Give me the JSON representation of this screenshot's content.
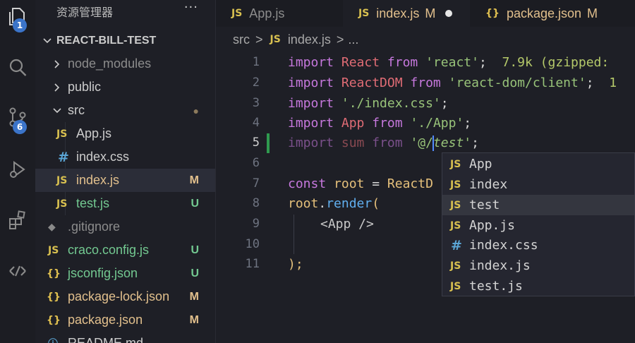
{
  "activity_bar": {
    "items": [
      {
        "name": "explorer-icon",
        "badge": "1"
      },
      {
        "name": "search-icon",
        "badge": ""
      },
      {
        "name": "source-control-icon",
        "badge": "6"
      },
      {
        "name": "run-debug-icon",
        "badge": ""
      },
      {
        "name": "extensions-icon",
        "badge": ""
      },
      {
        "name": "remote-icon",
        "badge": ""
      }
    ]
  },
  "sidebar": {
    "title": "资源管理器",
    "more": "···",
    "root": "REACT-BILL-TEST",
    "items": [
      {
        "label": "node_modules",
        "type": "folder",
        "status": ""
      },
      {
        "label": "public",
        "type": "folder",
        "status": ""
      },
      {
        "label": "src",
        "type": "folder-open",
        "status": "●"
      },
      {
        "label": "App.js",
        "type": "js",
        "status": ""
      },
      {
        "label": "index.css",
        "type": "css",
        "status": ""
      },
      {
        "label": "index.js",
        "type": "js",
        "status": "M"
      },
      {
        "label": "test.js",
        "type": "js",
        "status": "U"
      },
      {
        "label": ".gitignore",
        "type": "git",
        "status": ""
      },
      {
        "label": "craco.config.js",
        "type": "js",
        "status": "U"
      },
      {
        "label": "jsconfig.json",
        "type": "json",
        "status": "U"
      },
      {
        "label": "package-lock.json",
        "type": "json",
        "status": "M"
      },
      {
        "label": "package.json",
        "type": "json",
        "status": "M"
      },
      {
        "label": "README.md",
        "type": "md",
        "status": ""
      }
    ]
  },
  "tabs": [
    {
      "label": "App.js",
      "icon": "JS",
      "status": ""
    },
    {
      "label": "index.js",
      "icon": "JS",
      "status": "M"
    },
    {
      "label": "package.json",
      "icon": "{}",
      "status": "M"
    }
  ],
  "breadcrumb": {
    "folder": "src",
    "sep": ">",
    "icon": "JS",
    "file": "index.js",
    "tail": "..."
  },
  "editor": {
    "line_numbers": [
      "1",
      "2",
      "3",
      "4",
      "5",
      "6",
      "7",
      "8",
      "9",
      "10",
      "11"
    ],
    "line1": {
      "kw": "import",
      "id": "React",
      "from": "from",
      "str": "'react'",
      "semi": ";",
      "hint": "7.9k (gzipped: "
    },
    "line2": {
      "kw": "import",
      "id": "ReactDOM",
      "from": "from",
      "str": "'react-dom/client'",
      "semi": ";",
      "hint": "1"
    },
    "line3": {
      "kw": "import",
      "str": "'./index.css'",
      "semi": ";"
    },
    "line4": {
      "kw": "import",
      "id": "App",
      "from": "from",
      "str": "'./App'",
      "semi": ";"
    },
    "line5": {
      "kw": "import",
      "id": "sum",
      "from": "from",
      "str_pre": "'@/",
      "str_post": "test'",
      "semi": ";"
    },
    "line7": {
      "kw": "const",
      "var": "root",
      "eq": " = ",
      "id": "ReactD"
    },
    "line8": {
      "obj": "root",
      "dot": ".",
      "fn": "render",
      "paren": "("
    },
    "line9": {
      "tag": "<App />"
    },
    "line11": {
      "text": ");"
    }
  },
  "suggest": {
    "items": [
      {
        "icon": "JS",
        "label": "App"
      },
      {
        "icon": "JS",
        "label": "index"
      },
      {
        "icon": "JS",
        "label": "test"
      },
      {
        "icon": "JS",
        "label": "App.js"
      },
      {
        "icon": "#",
        "label": "index.css"
      },
      {
        "icon": "JS",
        "label": "index.js"
      },
      {
        "icon": "JS",
        "label": "test.js"
      }
    ]
  },
  "colors": {
    "accent": "#3b74c9",
    "modified": "#e2c08d",
    "untracked": "#73c991",
    "js_icon": "#d8c050"
  }
}
